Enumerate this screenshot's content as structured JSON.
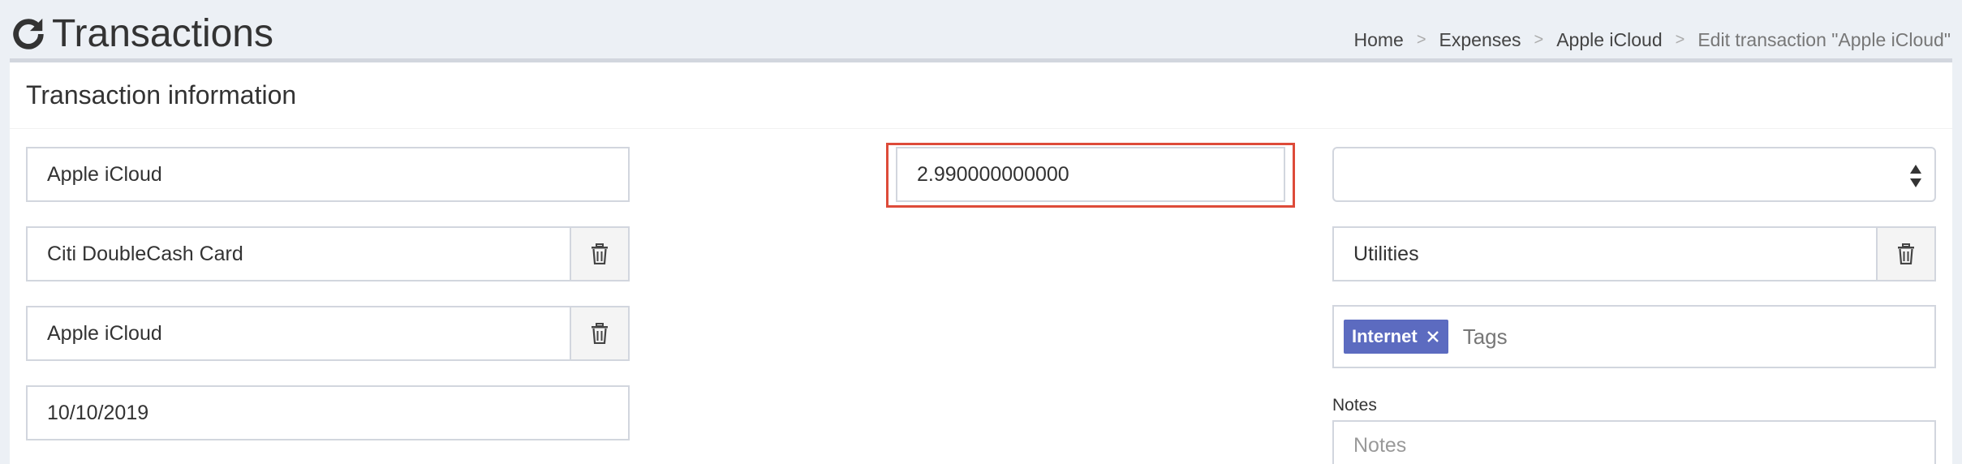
{
  "header": {
    "title": "Transactions",
    "icon": "refresh-icon"
  },
  "breadcrumb": {
    "items": [
      "Home",
      "Expenses",
      "Apple iCloud"
    ],
    "active": "Edit transaction \"Apple iCloud\"",
    "separator": ">"
  },
  "box": {
    "title": "Transaction information"
  },
  "form": {
    "description": "Apple iCloud",
    "source_account": "Citi DoubleCash Card",
    "destination_account": "Apple iCloud",
    "date": "10/10/2019",
    "amount": "2.990000000000",
    "budget": "",
    "category": "Utilities",
    "tags": [
      "Internet"
    ],
    "tags_placeholder": "Tags",
    "notes_label": "Notes",
    "notes_placeholder": "Notes"
  },
  "colors": {
    "highlight_border": "#dd4b39",
    "tag_bg": "#5c6bc0",
    "page_bg": "#ecf0f5"
  }
}
